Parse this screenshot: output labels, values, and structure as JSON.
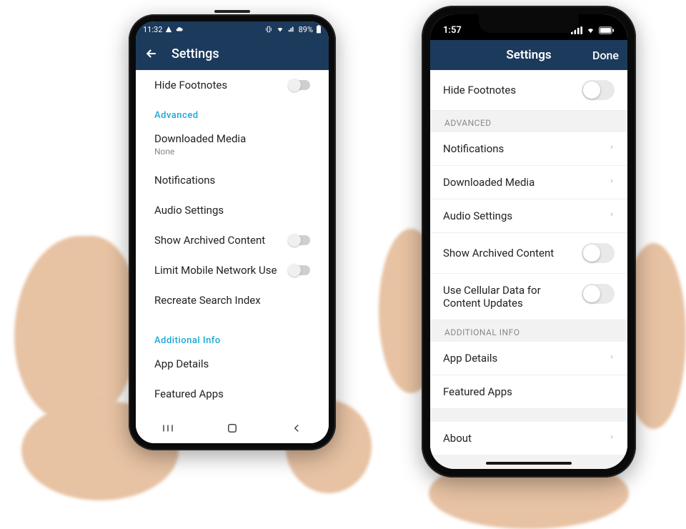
{
  "android": {
    "status": {
      "time": "11:32",
      "battery": "89%"
    },
    "navbar": {
      "title": "Settings"
    },
    "rows": {
      "hideFootnotes": "Hide Footnotes",
      "advancedHeader": "Advanced",
      "downloadedMedia": "Downloaded Media",
      "downloadedMediaSub": "None",
      "notifications": "Notifications",
      "audioSettings": "Audio Settings",
      "showArchived": "Show Archived Content",
      "limitMobile": "Limit Mobile Network Use",
      "recreateSearch": "Recreate Search Index",
      "additionalInfoHeader": "Additional Info",
      "appDetails": "App Details",
      "featuredApps": "Featured Apps"
    }
  },
  "ios": {
    "status": {
      "time": "1:57"
    },
    "navbar": {
      "title": "Settings",
      "done": "Done"
    },
    "rows": {
      "hideFootnotes": "Hide Footnotes",
      "advancedHeader": "ADVANCED",
      "notifications": "Notifications",
      "downloadedMedia": "Downloaded Media",
      "audioSettings": "Audio Settings",
      "showArchived": "Show Archived Content",
      "useCellular": "Use Cellular Data for Content Updates",
      "additionalInfoHeader": "ADDITIONAL INFO",
      "appDetails": "App Details",
      "featuredApps": "Featured Apps",
      "about": "About"
    }
  }
}
